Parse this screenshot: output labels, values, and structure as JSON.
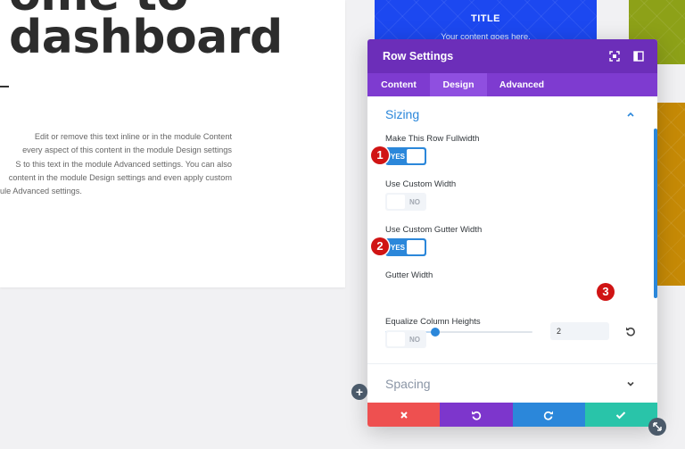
{
  "background": {
    "heading_lines": [
      "ome to",
      "dashboard"
    ],
    "body_lines": [
      "Edit or remove this text inline or in the module Content",
      "every aspect of this content in the module Design settings",
      "S to this text in the module Advanced settings. You can also",
      "content in the module Design settings and even apply custom",
      "ule Advanced settings."
    ],
    "blue_tile": {
      "title": "TITLE",
      "subtitle": "Your content goes here."
    }
  },
  "modal": {
    "title": "Row Settings",
    "tabs": [
      {
        "label": "Content",
        "active": false
      },
      {
        "label": "Design",
        "active": true
      },
      {
        "label": "Advanced",
        "active": false
      }
    ],
    "sections": {
      "sizing": "Sizing",
      "spacing": "Spacing"
    },
    "fields": {
      "fullwidth": {
        "label": "Make This Row Fullwidth",
        "value": "YES"
      },
      "custom_width": {
        "label": "Use Custom Width",
        "value": "NO"
      },
      "custom_gutter": {
        "label": "Use Custom Gutter Width",
        "value": "YES"
      },
      "gutter_width": {
        "label": "Gutter Width",
        "value": "2",
        "slider_fraction": 0.34
      },
      "equalize": {
        "label": "Equalize Column Heights",
        "value": "NO"
      }
    }
  },
  "badges": [
    "1",
    "2",
    "3"
  ],
  "icons": {
    "expand": "expand-icon",
    "sidebar": "sidebar-toggle-icon",
    "chevron_up": "chevron-up-icon",
    "chevron_down": "chevron-down-icon",
    "reset": "reset-icon",
    "cancel": "close-icon",
    "undo": "undo-icon",
    "redo": "redo-icon",
    "save": "check-icon",
    "add": "plus-icon",
    "resize": "resize-icon"
  },
  "colors": {
    "header": "#6c2eb9",
    "tabs": "#7e3bd0",
    "accent": "#2b87da",
    "cancel": "#ee5050",
    "undo": "#7d36cc",
    "redo": "#2b87da",
    "save": "#29c4a9",
    "badge": "#d01414"
  }
}
